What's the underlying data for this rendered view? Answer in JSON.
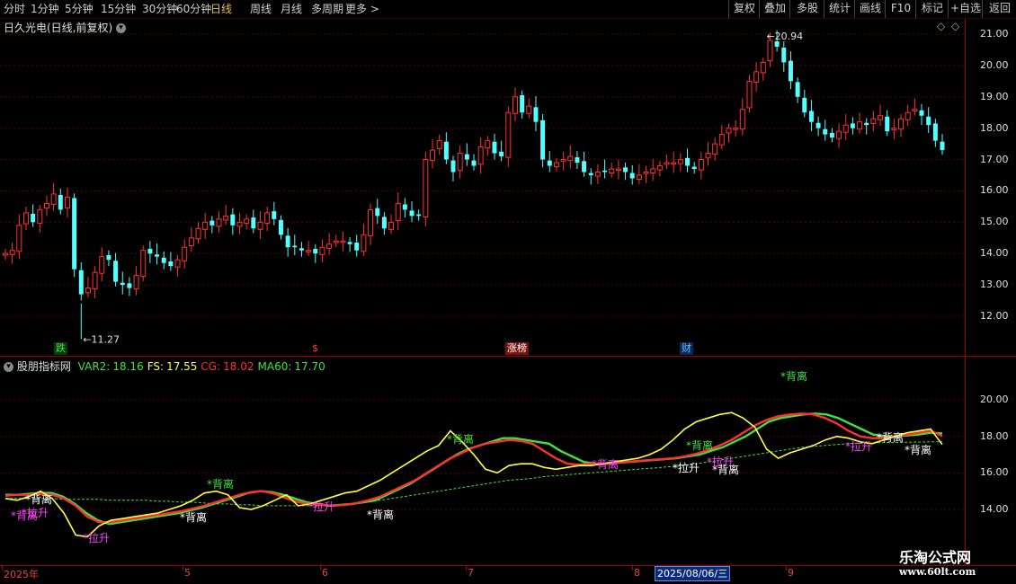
{
  "toolbar": {
    "periods": [
      "分时",
      "1分钟",
      "5分钟",
      "15分钟",
      "30分钟",
      "60分钟",
      "日线",
      "周线",
      "月线",
      "多周期",
      "更多 >"
    ],
    "active_period": "日线",
    "right_buttons": [
      "复权",
      "叠加",
      "多股",
      "统计",
      "画线",
      "F10",
      "标记",
      "+自选",
      "返回"
    ]
  },
  "main_panel": {
    "title": "日久光电(日线,前复权)",
    "high_label": "20.94",
    "low_label": "11.27",
    "tags": [
      {
        "text": "跌",
        "color": "#40e040",
        "bg": "#0a3a0a"
      },
      {
        "text": "$",
        "color": "#ff4040",
        "bg": "#000000"
      },
      {
        "text": "涨榜",
        "color": "#ffffff",
        "bg": "#7a1010"
      },
      {
        "text": "财",
        "color": "#60c0ff",
        "bg": "#0a2a5a"
      }
    ]
  },
  "indicator_panel": {
    "name": "股朋指标网",
    "values": [
      {
        "label": "VAR2:",
        "value": "18.16",
        "color": "#40e040"
      },
      {
        "label": "FS:",
        "value": "17.55",
        "color": "#ffff40"
      },
      {
        "label": "CG:",
        "value": "18.02",
        "color": "#ff3030"
      },
      {
        "label": "MA60:",
        "value": "17.70",
        "color": "#40e040"
      }
    ],
    "annotations": [
      "*背离",
      "*拉升",
      "*拉升",
      "*背离",
      "*背离",
      "*拉升",
      "*背离",
      "*背离",
      "*背离",
      "*拉升",
      "*背离",
      "*拉升",
      "*背离",
      "*背离",
      "*背离",
      "*拉升",
      "*背离",
      "*背离"
    ]
  },
  "chart_data": [
    {
      "type": "candlestick",
      "title": "日久光电(日线,前复权)",
      "y_ticks": [
        "21.00",
        "20.00",
        "19.00",
        "18.00",
        "17.00",
        "16.00",
        "15.00",
        "14.00",
        "13.00",
        "12.00"
      ],
      "ylim": [
        11.1,
        21.5
      ],
      "high": 20.94,
      "low": 11.27,
      "closes": [
        14.0,
        14.1,
        14.9,
        15.3,
        15.0,
        15.4,
        15.6,
        15.9,
        15.4,
        15.8,
        13.5,
        12.7,
        12.9,
        13.4,
        13.9,
        13.8,
        13.1,
        13.0,
        12.9,
        13.3,
        14.1,
        14.0,
        13.9,
        13.7,
        13.6,
        13.8,
        14.2,
        14.5,
        14.8,
        15.0,
        14.9,
        15.1,
        15.2,
        14.9,
        15.0,
        15.1,
        14.8,
        15.0,
        15.3,
        15.1,
        14.6,
        14.2,
        14.2,
        14.1,
        14.1,
        14.0,
        14.2,
        14.3,
        14.4,
        14.4,
        14.3,
        14.1,
        14.6,
        15.4,
        15.2,
        14.8,
        15.0,
        15.6,
        15.4,
        15.2,
        15.2,
        17.0,
        17.3,
        17.6,
        17.0,
        16.6,
        17.2,
        17.0,
        16.8,
        17.4,
        17.6,
        17.2,
        17.1,
        18.5,
        19.0,
        18.5,
        18.7,
        18.2,
        17.0,
        16.8,
        16.9,
        17.0,
        17.1,
        16.9,
        16.6,
        16.5,
        16.6,
        16.6,
        16.7,
        16.7,
        16.6,
        16.4,
        16.5,
        16.6,
        16.7,
        16.8,
        16.9,
        16.9,
        17.0,
        16.8,
        16.7,
        17.0,
        17.2,
        17.5,
        17.8,
        18.0,
        18.0,
        18.6,
        19.5,
        19.8,
        20.1,
        20.8,
        20.6,
        20.1,
        19.5,
        19.0,
        18.5,
        18.2,
        18.0,
        17.8,
        17.7,
        17.9,
        18.1,
        18.0,
        18.2,
        18.1,
        18.3,
        18.4,
        17.9,
        18.0,
        18.3,
        18.5,
        18.6,
        18.4,
        18.1,
        17.6,
        17.3
      ]
    },
    {
      "type": "line",
      "title": "股朋指标网",
      "y_ticks": [
        "20.00",
        "18.00",
        "16.00",
        "14.00"
      ],
      "ylim": [
        12.0,
        21.5
      ],
      "series": [
        {
          "name": "VAR2",
          "color": "#40e040",
          "values": [
            14.8,
            14.8,
            14.85,
            14.9,
            14.9,
            14.7,
            14.3,
            13.8,
            13.4,
            13.2,
            13.3,
            13.4,
            13.5,
            13.6,
            13.7,
            13.8,
            13.95,
            14.1,
            14.3,
            14.5,
            14.7,
            14.9,
            15.0,
            14.95,
            14.8,
            14.6,
            14.4,
            14.3,
            14.2,
            14.25,
            14.3,
            14.4,
            14.5,
            14.8,
            15.1,
            15.4,
            15.8,
            16.2,
            16.6,
            17.0,
            17.3,
            17.5,
            17.7,
            17.9,
            17.9,
            17.8,
            17.7,
            17.6,
            17.2,
            16.9,
            16.6,
            16.5,
            16.5,
            16.55,
            16.6,
            16.65,
            16.7,
            16.75,
            16.8,
            16.9,
            17.0,
            17.2,
            17.4,
            17.7,
            18.0,
            18.4,
            18.8,
            19.0,
            19.1,
            19.2,
            19.25,
            19.2,
            19.0,
            18.7,
            18.4,
            18.1,
            18.0,
            18.0,
            18.05,
            18.1,
            18.2,
            18.16
          ]
        },
        {
          "name": "FS",
          "color": "#ffff40",
          "values": [
            14.6,
            14.5,
            14.7,
            15.0,
            14.6,
            13.8,
            12.6,
            12.5,
            13.1,
            13.4,
            13.5,
            13.6,
            13.7,
            13.8,
            14.0,
            14.2,
            14.5,
            14.9,
            15.0,
            14.8,
            14.1,
            14.0,
            14.2,
            14.5,
            14.8,
            14.2,
            14.3,
            14.5,
            14.7,
            14.9,
            15.0,
            15.3,
            15.6,
            16.0,
            16.4,
            16.8,
            17.2,
            17.5,
            18.3,
            17.7,
            17.0,
            16.2,
            16.0,
            16.4,
            16.5,
            16.5,
            16.3,
            16.2,
            16.3,
            16.4,
            16.4,
            16.5,
            16.6,
            16.7,
            16.8,
            17.0,
            17.3,
            17.8,
            18.4,
            18.8,
            19.0,
            19.2,
            19.3,
            19.0,
            18.5,
            17.3,
            16.8,
            17.1,
            17.3,
            17.5,
            17.8,
            18.0,
            17.9,
            17.7,
            17.6,
            17.8,
            18.0,
            18.2,
            18.3,
            18.4,
            17.55
          ]
        },
        {
          "name": "CG",
          "color": "#ff3030",
          "values": [
            14.75,
            14.8,
            14.8,
            14.85,
            14.8,
            14.6,
            14.2,
            13.6,
            13.3,
            13.3,
            13.4,
            13.5,
            13.6,
            13.7,
            13.8,
            13.9,
            14.05,
            14.2,
            14.4,
            14.6,
            14.8,
            14.95,
            15.0,
            14.85,
            14.6,
            14.4,
            14.3,
            14.25,
            14.2,
            14.25,
            14.35,
            14.5,
            14.7,
            15.0,
            15.3,
            15.6,
            16.0,
            16.4,
            16.8,
            17.1,
            17.4,
            17.6,
            17.7,
            17.8,
            17.75,
            17.6,
            17.2,
            16.8,
            16.5,
            16.45,
            16.5,
            16.5,
            16.55,
            16.6,
            16.65,
            16.7,
            16.75,
            16.8,
            16.9,
            17.05,
            17.25,
            17.5,
            17.8,
            18.2,
            18.6,
            18.9,
            19.1,
            19.2,
            19.25,
            19.2,
            19.0,
            18.7,
            18.3,
            18.0,
            17.9,
            17.9,
            18.0,
            18.1,
            18.2,
            18.3,
            18.02
          ]
        },
        {
          "name": "MA60",
          "color": "#40e040",
          "values": [
            14.6,
            14.6,
            14.6,
            14.6,
            14.6,
            14.55,
            14.55,
            14.55,
            14.55,
            14.5,
            14.5,
            14.5,
            14.5,
            14.45,
            14.45,
            14.4,
            14.4,
            14.35,
            14.3,
            14.3,
            14.25,
            14.25,
            14.2,
            14.2,
            14.2,
            14.2,
            14.2,
            14.2,
            14.25,
            14.3,
            14.35,
            14.4,
            14.5,
            14.6,
            14.7,
            14.8,
            14.9,
            15.0,
            15.1,
            15.2,
            15.3,
            15.4,
            15.5,
            15.6,
            15.65,
            15.7,
            15.8,
            15.85,
            15.9,
            15.95,
            16.0,
            16.05,
            16.1,
            16.15,
            16.2,
            16.25,
            16.3,
            16.35,
            16.4,
            16.5,
            16.6,
            16.7,
            16.8,
            16.9,
            17.0,
            17.1,
            17.2,
            17.3,
            17.4,
            17.45,
            17.5,
            17.55,
            17.6,
            17.62,
            17.64,
            17.66,
            17.67,
            17.68,
            17.69,
            17.7,
            17.7
          ]
        }
      ]
    }
  ],
  "x_axis": {
    "months": [
      "2025年",
      "5",
      "6",
      "7",
      "8",
      "9"
    ],
    "cursor_date": "2025/08/06/三"
  },
  "watermark": {
    "line1": "乐淘公式网",
    "line2": "www.60lt.com"
  },
  "colors": {
    "up": "#ff3232",
    "down": "#54ffff",
    "grid": "#5a0000",
    "frame": "#a00000"
  }
}
